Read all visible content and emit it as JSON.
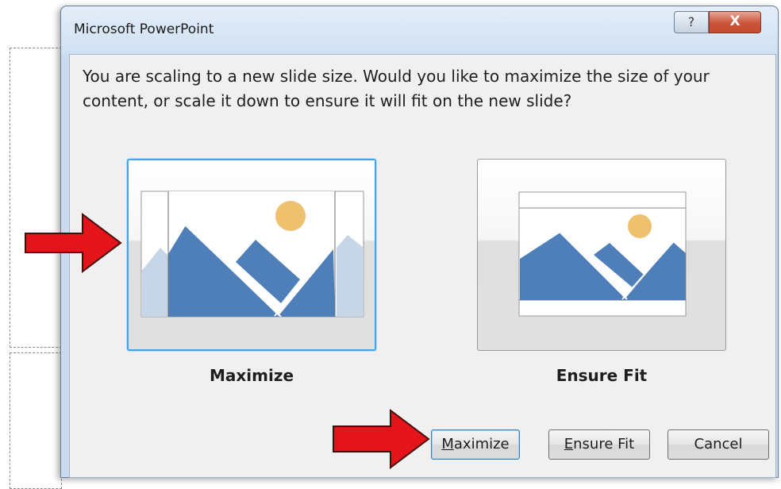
{
  "dialog": {
    "title": "Microsoft PowerPoint",
    "help_glyph": "?",
    "close_glyph": "X",
    "message": "You are scaling to a new slide size.  Would you like to maximize the size of your content, or scale it down to ensure it will fit on the new slide?"
  },
  "options": [
    {
      "label": "Maximize",
      "selected": true
    },
    {
      "label": "Ensure Fit",
      "selected": false
    }
  ],
  "buttons": {
    "maximize": {
      "mnemonic": "M",
      "rest": "aximize"
    },
    "ensure_fit": {
      "mnemonic": "E",
      "rest": "nsure Fit"
    },
    "cancel": "Cancel"
  },
  "colors": {
    "accent": "#4aa3dc",
    "mountain": "#4e7fb8",
    "sun": "#eec16f",
    "arrow": "#e3141a"
  },
  "icons": [
    "help-icon",
    "close-icon",
    "maximize-preview-icon",
    "ensure-fit-preview-icon",
    "red-arrow-icon"
  ]
}
